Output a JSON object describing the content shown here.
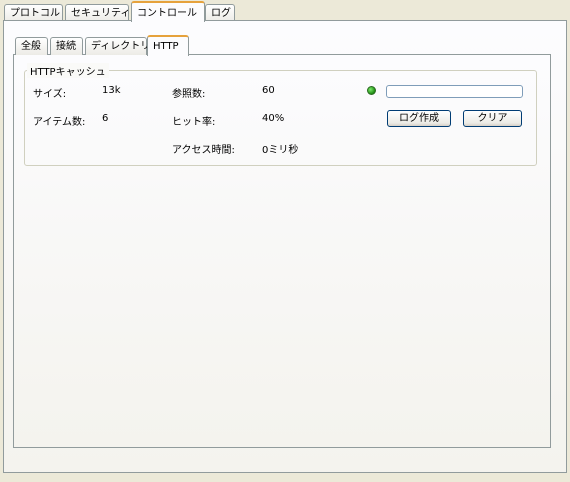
{
  "outer_tabs": [
    "プロトコル",
    "セキュリティ",
    "コントロール",
    "ログ"
  ],
  "inner_tabs": [
    "全般",
    "接続",
    "ディレクトリ",
    "HTTP"
  ],
  "cache_group": {
    "title": "HTTPキャッシュ",
    "size_label": "サイズ:",
    "size_value": "13k",
    "items_label": "アイテム数:",
    "items_value": "6",
    "refs_label": "参照数:",
    "refs_value": "60",
    "hit_label": "ヒット率:",
    "hit_value": "40%",
    "access_label": "アクセス時間:",
    "access_value": "0ミリ秒",
    "progress_fraction": 0
  },
  "buttons": {
    "create_log": "ログ作成",
    "clear": "クリア"
  },
  "colors": {
    "active_tab_accent": "#E6A23C",
    "status_led": "#1E8A12",
    "button_border": "#003C74"
  }
}
